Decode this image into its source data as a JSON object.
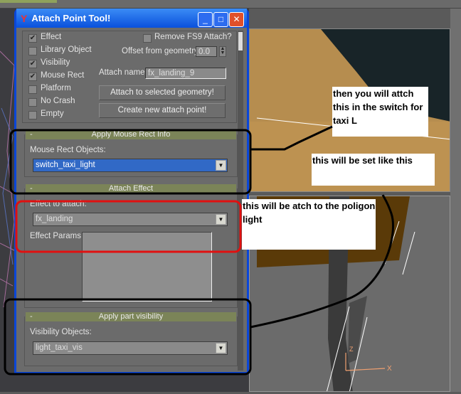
{
  "dialog": {
    "title": "Attach Point Tool!",
    "checkboxes": [
      {
        "label": "Effect",
        "checked": true
      },
      {
        "label": "Library Object",
        "checked": false
      },
      {
        "label": "Visibility",
        "checked": true
      },
      {
        "label": "Mouse Rect",
        "checked": true
      },
      {
        "label": "Platform",
        "checked": false
      },
      {
        "label": "No Crash",
        "checked": false
      },
      {
        "label": "Empty",
        "checked": false
      }
    ],
    "remove_fs9_label": "Remove FS9 Attach?",
    "offset_label": "Offset from geometry:",
    "offset_value": "0.0",
    "attach_name_label": "Attach name:",
    "attach_name_value": "fx_landing_9",
    "attach_button": "Attach to selected geometry!",
    "create_button": "Create new attach point!",
    "mouse_rect": {
      "header": "Apply Mouse Rect Info",
      "collapse": "-",
      "label": "Mouse Rect Objects:",
      "value": "switch_taxi_light"
    },
    "effect": {
      "header": "Attach Effect",
      "collapse": "-",
      "label": "Effect to attach:",
      "value": "fx_landing",
      "params_label": "Effect Params:"
    },
    "visibility": {
      "header": "Apply part visibility",
      "collapse": "-",
      "label": "Visibility Objects:",
      "value": "light_taxi_vis"
    }
  },
  "notes": {
    "n1": "then you will attch this in the switch for taxi L",
    "n2": "this will be set like this",
    "n3": "this will be atch to the poligon light"
  },
  "viewport": {
    "axis_x": "X",
    "axis_z": "Z"
  }
}
